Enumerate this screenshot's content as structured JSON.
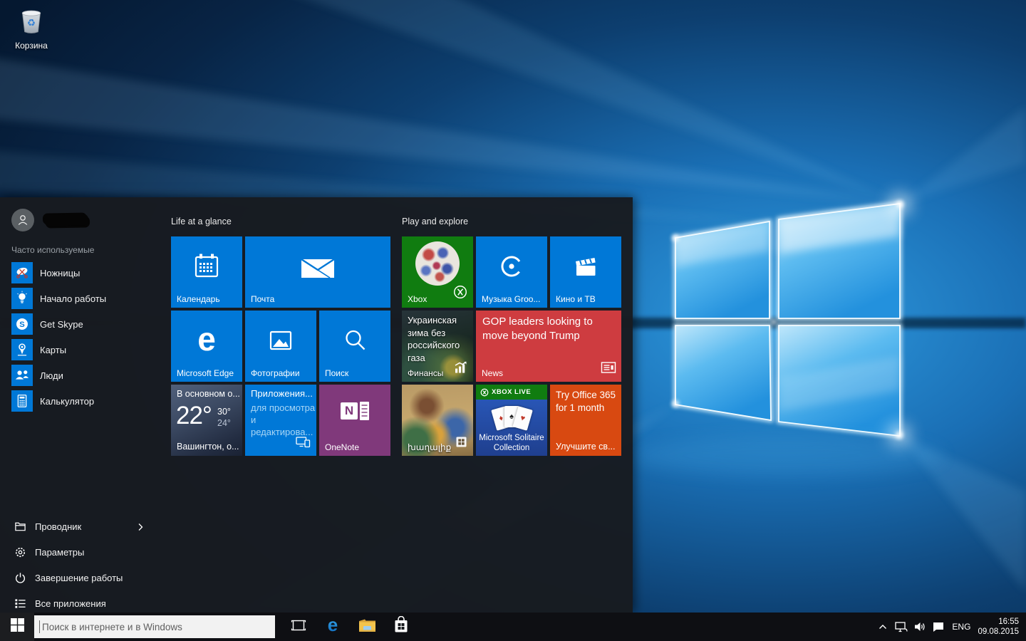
{
  "colors": {
    "accent_blue": "#0078D7",
    "onenote_purple": "#80397B",
    "xbox_green": "#107C10",
    "news_red": "#CE3C40",
    "office_orange": "#D84911",
    "live_green": "#107C10"
  },
  "desktop": {
    "recycle_bin": {
      "label": "Корзина"
    }
  },
  "start_menu": {
    "frequent_header": "Часто используемые",
    "frequent_items": [
      {
        "label": "Ножницы"
      },
      {
        "label": "Начало работы"
      },
      {
        "label": "Get Skype"
      },
      {
        "label": "Карты"
      },
      {
        "label": "Люди"
      },
      {
        "label": "Калькулятор"
      }
    ],
    "footer_items": [
      {
        "label": "Проводник"
      },
      {
        "label": "Параметры"
      },
      {
        "label": "Завершение работы"
      },
      {
        "label": "Все приложения"
      }
    ],
    "groups": [
      {
        "title": "Life at a glance",
        "tiles": [
          {
            "id": "calendar",
            "label": "Календарь"
          },
          {
            "id": "mail",
            "label": "Почта"
          },
          {
            "id": "edge",
            "label": "Microsoft Edge"
          },
          {
            "id": "photos",
            "label": "Фотографии"
          },
          {
            "id": "search",
            "label": "Поиск"
          },
          {
            "id": "weather",
            "condition": "В основном о...",
            "temp": "22°",
            "high": "30°",
            "low": "24°",
            "location": "Вашингтон, о..."
          },
          {
            "id": "apps_promo",
            "title": "Приложения...",
            "body_lines": [
              "для просмотра",
              "и",
              "редактирова..."
            ]
          },
          {
            "id": "onenote",
            "label": "OneNote"
          }
        ]
      },
      {
        "title": "Play and explore",
        "tiles": [
          {
            "id": "xbox",
            "label": "Xbox"
          },
          {
            "id": "groove",
            "label": "Музыка Groo..."
          },
          {
            "id": "movies",
            "label": "Кино и ТВ"
          },
          {
            "id": "finance",
            "headline": "Украинская зима без российского газа",
            "label": "Финансы"
          },
          {
            "id": "news",
            "headline": "GOP leaders looking to move beyond Trump",
            "label": "News"
          },
          {
            "id": "game",
            "label": "խաղալիք"
          },
          {
            "id": "solitaire",
            "badge": "XBOX LIVE",
            "label": "Microsoft Solitaire Collection"
          },
          {
            "id": "office",
            "title": "Try Office 365 for 1 month",
            "subtitle": "Улучшите св..."
          }
        ]
      }
    ]
  },
  "taskbar": {
    "search_placeholder": "Поиск в интернете и в Windows",
    "tray": {
      "language": "ENG",
      "time": "16:55",
      "date": "09.08.2015"
    }
  }
}
